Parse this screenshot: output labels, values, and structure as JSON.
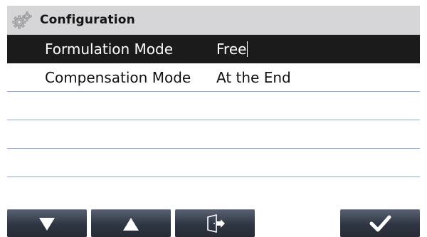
{
  "header": {
    "title": "Configuration",
    "icon": "gears-icon"
  },
  "settings": [
    {
      "label": "Formulation Mode",
      "value": "Free",
      "selected": true
    },
    {
      "label": "Compensation Mode",
      "value": "At the End",
      "selected": false
    }
  ],
  "empty_rows": 4,
  "footer": {
    "buttons": [
      {
        "name": "down-button",
        "icon": "arrow-down-icon"
      },
      {
        "name": "up-button",
        "icon": "arrow-up-icon"
      },
      {
        "name": "exit-button",
        "icon": "exit-door-icon"
      },
      {
        "name": "confirm-button",
        "icon": "checkmark-icon"
      }
    ]
  },
  "colors": {
    "header_bg": "#d6d6d9",
    "selected_row_bg": "#1b1b1b",
    "row_divider": "#9aa7c3",
    "button_bg": "#2f3542"
  }
}
